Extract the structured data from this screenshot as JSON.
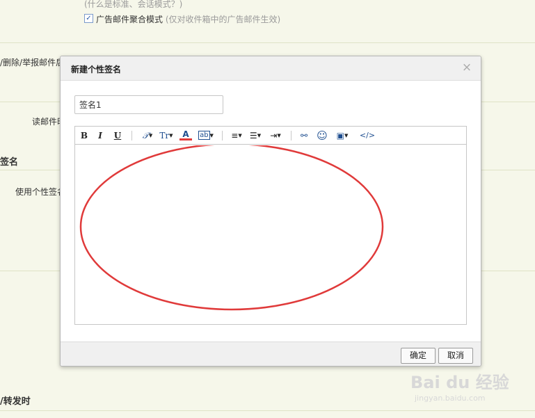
{
  "background": {
    "mode_hint": "(什么是标准、会话模式？)",
    "ad_merge_label": "广告邮件聚合模式",
    "ad_merge_hint": "(仅对收件箱中的广告邮件生效)",
    "left_text_1": "/删除/举报邮件后",
    "left_text_2": "读邮件时",
    "section_heading": "签名",
    "left_text_3": "使用个性签名",
    "bottom_heading": "/转发时"
  },
  "dialog": {
    "title": "新建个性签名",
    "close_glyph": "×",
    "signature_name": "签名1",
    "toolbar": {
      "bold": "B",
      "italic": "I",
      "underline": "U",
      "font": "𝒯",
      "size": "Tr",
      "color": "A",
      "bg_color": "ab",
      "align": "≡",
      "list": "☰",
      "indent": "⇥",
      "link": "⚯",
      "emoji": "☺",
      "image": "▣",
      "code": "</>"
    },
    "ok_label": "确定",
    "cancel_label": "取消"
  },
  "watermark": {
    "logo": "Bai du 经验",
    "url": "jingyan.baidu.com"
  },
  "colors": {
    "annotation_red": "#e03a3a",
    "page_background": "#f6f7ea",
    "toolbar_blue": "#1d4d8f"
  }
}
